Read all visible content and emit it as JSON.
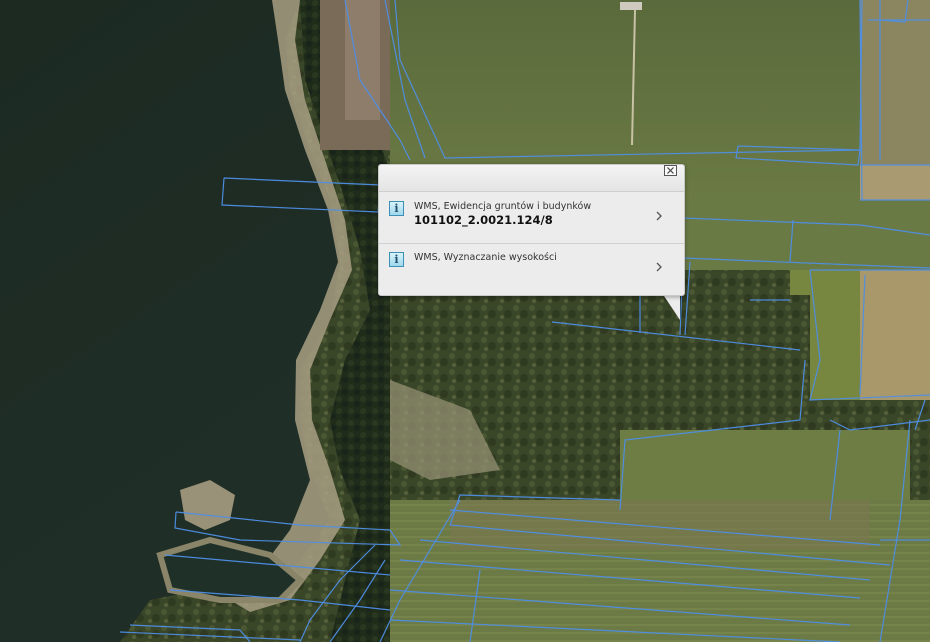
{
  "popup": {
    "close_label": "×",
    "results": [
      {
        "source": "WMS, Ewidencja gruntów i budynków",
        "value": "101102_2.0021.124/8",
        "icon": "info-icon"
      },
      {
        "source": "WMS, Wyznaczanie wysokości",
        "value": "",
        "icon": "info-icon"
      }
    ]
  },
  "map": {
    "layers": [
      "orthophoto",
      "parcel-boundaries"
    ],
    "parcel_line_color": "#4f8fe6"
  }
}
